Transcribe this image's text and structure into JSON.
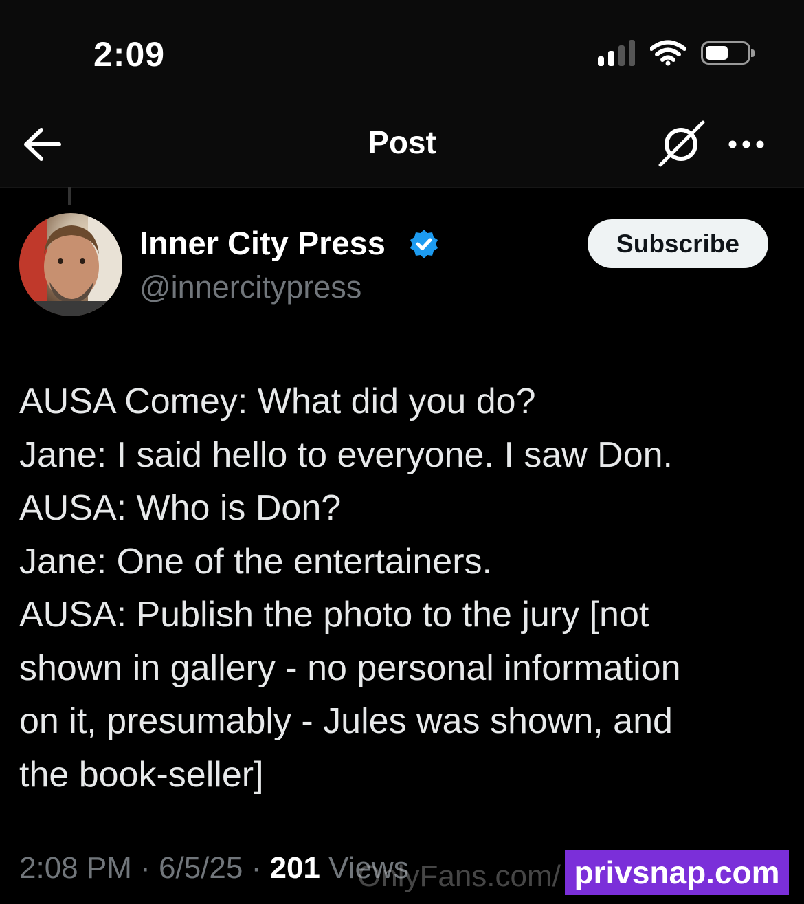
{
  "status_bar": {
    "time": "2:09",
    "signal_icon": "cellular-signal-icon",
    "wifi_icon": "wifi-icon",
    "battery_icon": "battery-icon",
    "battery_level": 0.45
  },
  "nav": {
    "back_icon": "arrow-left-icon",
    "title": "Post",
    "grok_icon": "grok-icon",
    "more_icon": "more-horizontal-icon"
  },
  "author": {
    "display_name": "Inner City Press",
    "handle": "@innercitypress",
    "verified_icon": "verified-badge-icon",
    "verified_color": "#1d9bf0"
  },
  "subscribe": {
    "label": "Subscribe"
  },
  "post": {
    "lines": [
      "AUSA Comey: What did you do?",
      "Jane: I said hello to everyone. I saw Don.",
      "AUSA: Who is Don?",
      "Jane: One of the entertainers.",
      "AUSA: Publish the photo to the jury [not",
      "shown in gallery - no personal information",
      "on it, presumably - Jules was shown, and",
      "the book-seller]"
    ]
  },
  "meta": {
    "time": "2:08 PM",
    "date": "6/5/25",
    "views_count": "201",
    "views_label": "Views"
  },
  "watermark": {
    "ghost_text": "OnlyFans.com/",
    "badge_text": "privsnap.com",
    "badge_color": "#7b2fd9"
  }
}
